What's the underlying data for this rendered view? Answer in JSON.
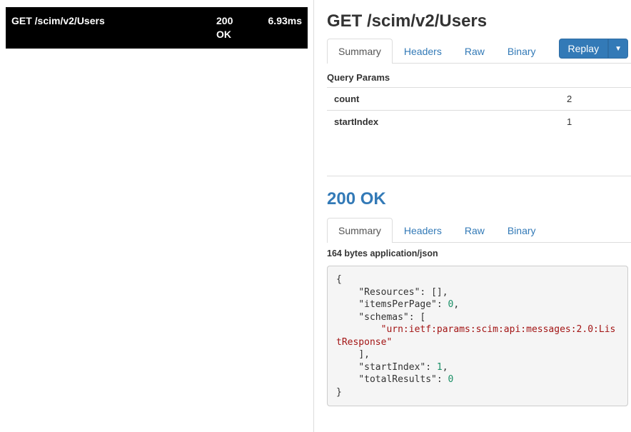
{
  "sidebar": {
    "request": {
      "line": "GET /scim/v2/Users",
      "status_code": "200",
      "status_text": "OK",
      "timing": "6.93ms"
    }
  },
  "request_panel": {
    "title": "GET /scim/v2/Users",
    "tabs": [
      "Summary",
      "Headers",
      "Raw",
      "Binary"
    ],
    "active_tab": "Summary",
    "replay_label": "Replay",
    "query_params_heading": "Query Params",
    "query_params": [
      {
        "key": "count",
        "value": "2"
      },
      {
        "key": "startIndex",
        "value": "1"
      }
    ]
  },
  "response_panel": {
    "status_line": "200 OK",
    "tabs": [
      "Summary",
      "Headers",
      "Raw",
      "Binary"
    ],
    "active_tab": "Summary",
    "meta": "164 bytes application/json",
    "body": {
      "key_Resources": "\"Resources\"",
      "val_Resources": "[]",
      "key_itemsPerPage": "\"itemsPerPage\"",
      "val_itemsPerPage": "0",
      "key_schemas": "\"schemas\"",
      "val_schema_str": "\"urn:ietf:params:scim:api:messages:2.0:ListResponse\"",
      "key_startIndex": "\"startIndex\"",
      "val_startIndex": "1",
      "key_totalResults": "\"totalResults\"",
      "val_totalResults": "0"
    }
  }
}
